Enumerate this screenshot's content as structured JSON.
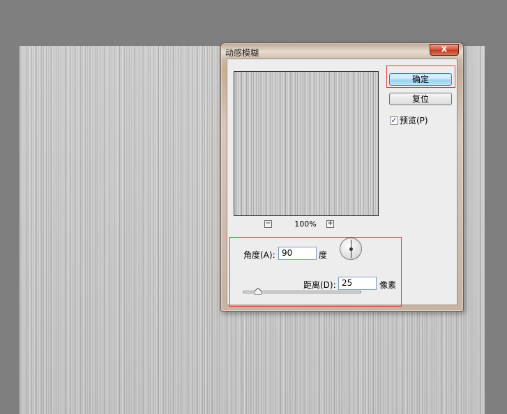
{
  "dialog": {
    "title": "动感模糊",
    "close_label": "x"
  },
  "preview": {
    "zoom_out_label": "−",
    "zoom_level": "100%",
    "zoom_in_label": "+"
  },
  "buttons": {
    "ok_label": "确定",
    "reset_label": "复位"
  },
  "preview_checkbox": {
    "label": "预览(P)",
    "checked": true,
    "check_glyph": "✓"
  },
  "angle": {
    "label": "角度(A):",
    "value": "90",
    "unit": "度"
  },
  "distance": {
    "label": "距离(D):",
    "value": "25",
    "unit": "像素",
    "slider_fraction": 0.13
  },
  "colors": {
    "highlight_box": "#e53a3a",
    "ok_button": "#98d1ef"
  }
}
